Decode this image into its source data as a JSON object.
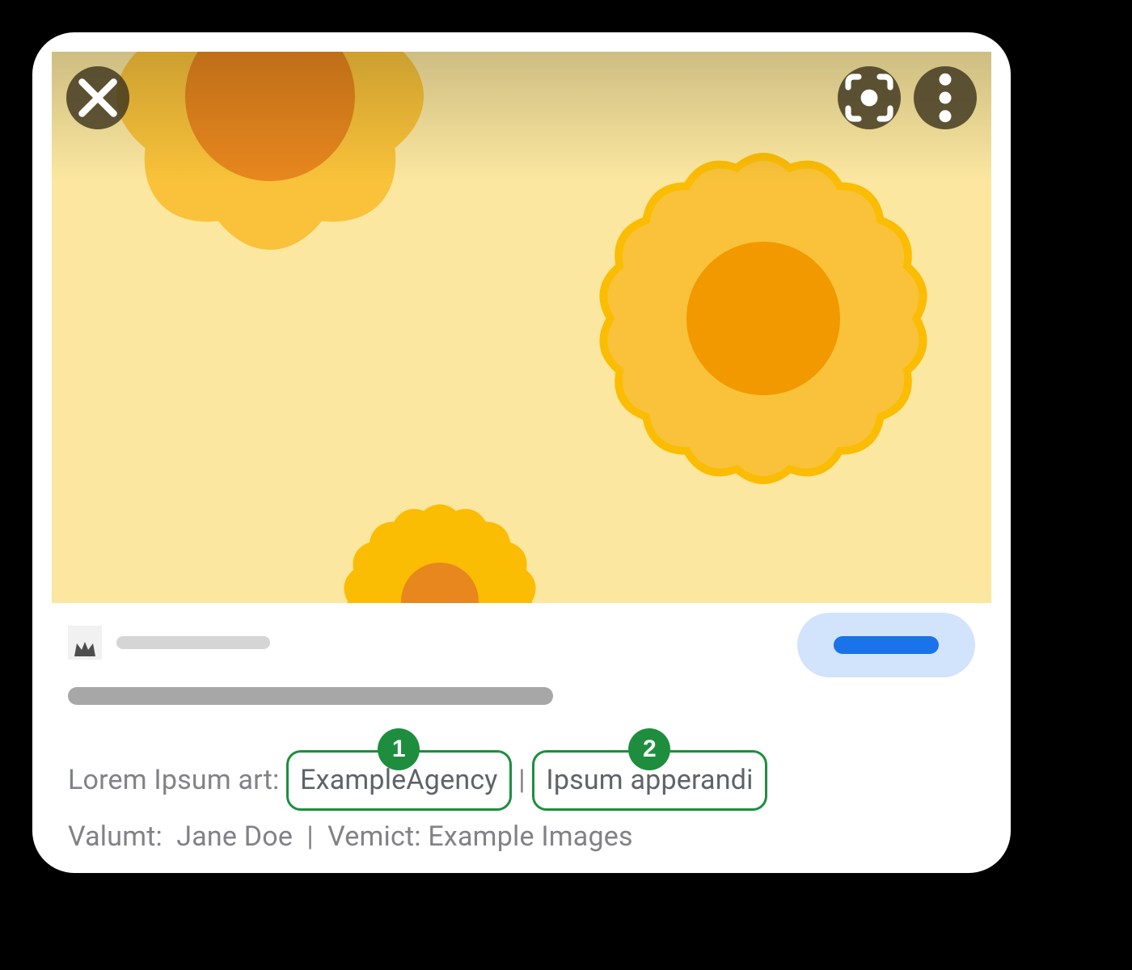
{
  "callouts": {
    "one": {
      "number": "1",
      "text": "ExampleAgency"
    },
    "two": {
      "number": "2",
      "text": "Ipsum apperandi"
    }
  },
  "credits": {
    "line1_prefix": "Lorem Ipsum art:",
    "line1_separator": "|",
    "line2_prefix": "Valumt:",
    "line2_value": "Jane Doe",
    "line2_separator": "|",
    "line2_suffix_label": "Vemict:",
    "line2_suffix_value": "Example Images"
  }
}
